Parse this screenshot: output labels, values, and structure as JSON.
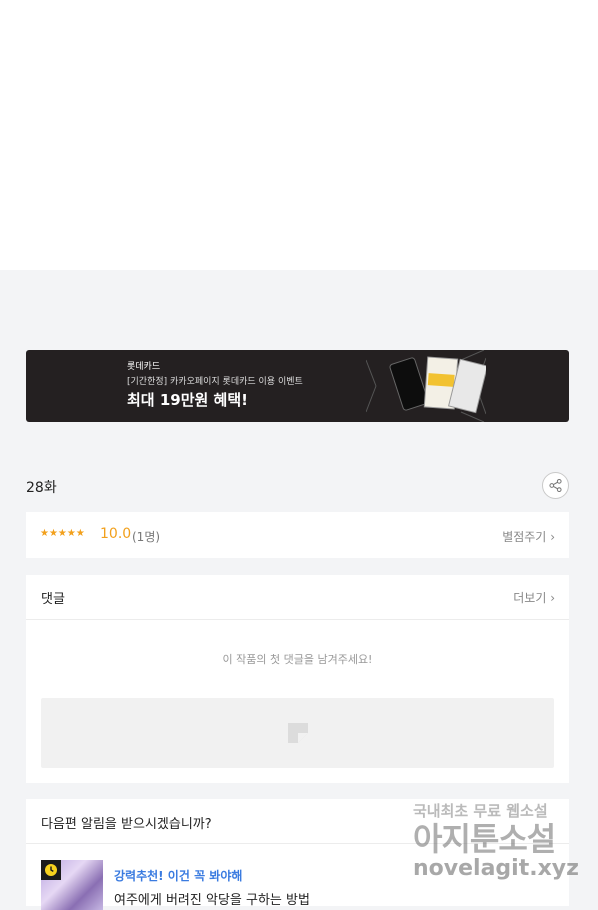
{
  "banner": {
    "brand": "롯데카드",
    "subtitle": "[기간한정] 카카오페이지 롯데카드 이용 이벤트",
    "headline": "최대 19만원 혜택!",
    "background_color": "#242021"
  },
  "episode": {
    "title": "28화",
    "share_icon": "share-icon"
  },
  "rating": {
    "stars": "★★★★★",
    "score": "10.0",
    "count": "(1명)",
    "rate_link": "별점주기",
    "accent_color": "#f2a01c"
  },
  "comments": {
    "title": "댓글",
    "more_link": "더보기",
    "empty_message": "이 작품의 첫 댓글을 남겨주세요!"
  },
  "notify": {
    "title": "다음편 알림을 받으시겠습니까?",
    "recommend_label": "강력추천! 이건 꼭 봐야해",
    "recommend_title": "여주에게 버려진 악당을 구하는 방법",
    "label_color": "#3a7be0"
  },
  "watermark": {
    "line1": "국내최초 무료 웹소설",
    "line2": "아지툰소설",
    "line3": "novelagit.xyz"
  }
}
